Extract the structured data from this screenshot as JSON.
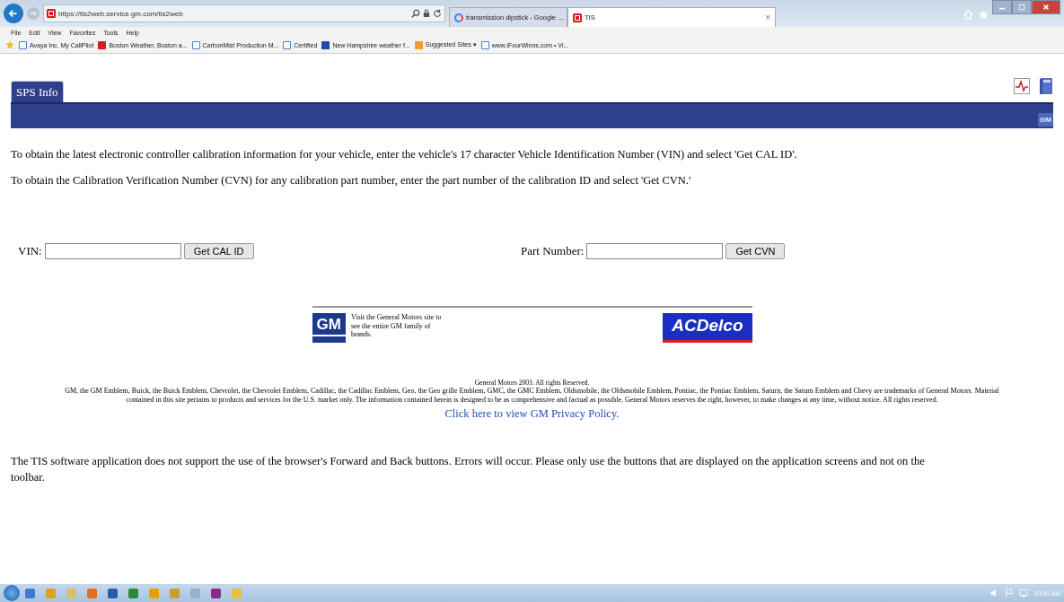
{
  "browser": {
    "address": "https://tis2web.service.gm.com/tis2web",
    "tabs": [
      {
        "title": "transmission dipstick - Google ...",
        "kind": "google",
        "selected": false
      },
      {
        "title": "TIS",
        "kind": "tis",
        "selected": true,
        "close": "×"
      }
    ],
    "menu": [
      "File",
      "Edit",
      "View",
      "Favorites",
      "Tools",
      "Help"
    ],
    "favorites": [
      {
        "label": "Avaya Inc. My CallPilot",
        "kind": "page"
      },
      {
        "label": "Boston Weather, Boston a...",
        "kind": "weather"
      },
      {
        "label": "CarbonMist Production M...",
        "kind": "page"
      },
      {
        "label": "Certified",
        "kind": "page"
      },
      {
        "label": "New Hampshire weather f...",
        "kind": "tile"
      },
      {
        "label": "Suggested Sites ▾",
        "kind": "suggested"
      },
      {
        "label": "www.iFourWinns.com • Vi...",
        "kind": "page"
      }
    ]
  },
  "app": {
    "tabs": [
      {
        "label": "SPS Info",
        "selected": true
      }
    ],
    "bar_logo": "GM"
  },
  "instructions": [
    "To obtain the latest electronic controller calibration information for your vehicle, enter the vehicle's 17 character Vehicle Identification Number (VIN) and select 'Get CAL ID'.",
    "To obtain the Calibration Verification Number (CVN) for any calibration part number, enter the part number of the calibration ID and select 'Get CVN.'"
  ],
  "forms": [
    {
      "label": "VIN:",
      "button": "Get CAL ID"
    },
    {
      "label": "Part Number:",
      "button": "Get CVN"
    }
  ],
  "footer": {
    "gm_logo": "GM",
    "gm_text": "Visit the General Motors site to see the entire GM family of brands.",
    "acdelco_logo": "ACDelco",
    "copyright": "General Motors 2003. All rights Reserved.",
    "trademarks": "GM, the GM Emblem, Buick, the Buick Emblem, Chevrolet, the Chevrolet Emblem, Cadillac, the Cadillac Emblem, Geo, the Geo grille Emblem, GMC, the GMC Emblem, Oldsmobile, the Oldsmobile Emblem, Pontiac, the Pontiac Emblem, Saturn, the Saturn Emblem and Chevy are trademarks of General Motors. Material contained in this site pertains to products and services for the U.S. market only. The information contained herein is designed to be as comprehensive and factual as possible. General Motors reserves the right, however, to make changes at any time, without notice. All rights reserved.",
    "privacy_link": "Click here to view GM Privacy Policy."
  },
  "notice": "The TIS software application does not support the use of the browser's Forward and Back buttons. Errors will occur. Please only use the buttons that are displayed on the application screens and not on the toolbar.",
  "taskbar": {
    "apps": [
      {
        "color": "#3a7bd5"
      },
      {
        "color": "#e0a020"
      },
      {
        "color": "#d8c070"
      },
      {
        "color": "#e07020"
      },
      {
        "color": "#2a5aa8"
      },
      {
        "color": "#2a8a3a"
      },
      {
        "color": "#e8a000"
      },
      {
        "color": "#c8a030"
      },
      {
        "color": "#9ab0c8"
      },
      {
        "color": "#8a2a8a"
      },
      {
        "color": "#e8c040"
      }
    ],
    "clock": "10:00 AM"
  }
}
